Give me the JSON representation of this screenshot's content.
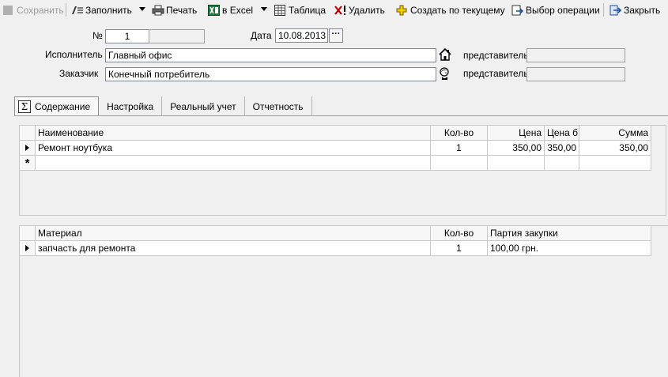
{
  "toolbar": {
    "save": "Сохранить",
    "fill": "Заполнить",
    "print": "Печать",
    "excel": "в Excel",
    "table": "Таблица",
    "delete": "Удалить",
    "create_from_current": "Создать по текущему",
    "select_operation": "Выбор операции",
    "close": "Закрыть"
  },
  "header": {
    "number_label": "№",
    "number_value": "1",
    "number_extra": "",
    "date_label": "Дата",
    "date_value": "10.08.2013",
    "date_button": "···",
    "executor_label": "Исполнитель",
    "executor_value": "Главный офис",
    "executor_rep_label": "представитель",
    "executor_rep_value": "",
    "customer_label": "Заказчик",
    "customer_value": "Конечный потребитель",
    "customer_rep_label": "представитель",
    "customer_rep_value": ""
  },
  "tabs": [
    {
      "label": "Содержание",
      "icon": "Σ"
    },
    {
      "label": "Настройка"
    },
    {
      "label": "Реальный учет"
    },
    {
      "label": "Отчетность"
    }
  ],
  "services_grid": {
    "columns": [
      "Наименование",
      "Кол-во",
      "Цена",
      "Цена б",
      "Сумма"
    ],
    "rows": [
      {
        "name": "Ремонт ноутбука",
        "qty": "1",
        "price": "350,00",
        "price_b": "350,00",
        "sum": "350,00"
      }
    ],
    "new_row_marker": "*"
  },
  "materials_grid": {
    "columns": [
      "Материал",
      "Кол-во",
      "Партия закупки"
    ],
    "rows": [
      {
        "material": "запчасть для ремонта",
        "qty": "1",
        "batch": "100,00 грн."
      }
    ]
  }
}
